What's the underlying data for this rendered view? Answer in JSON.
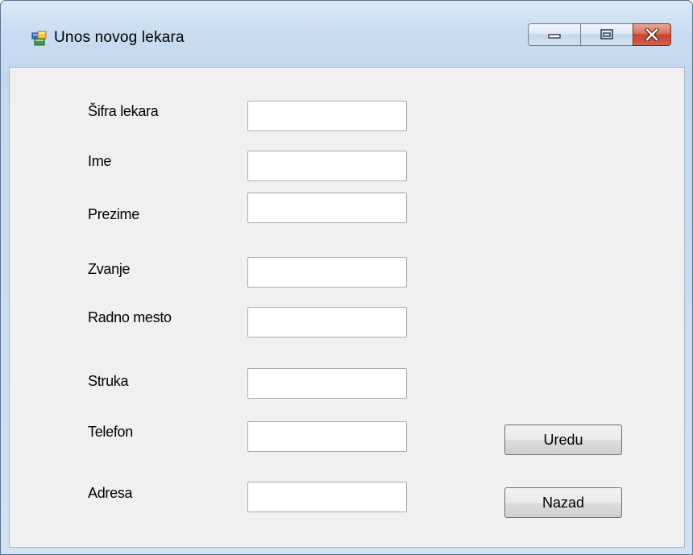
{
  "window": {
    "title": "Unos novog lekara",
    "icons": {
      "app": "app-window-icon",
      "minimize": "minimize-icon",
      "maximize": "maximize-icon",
      "close": "close-icon"
    },
    "colors": {
      "frame": "#c9dcf1",
      "client": "#f0f0f0",
      "close_button": "#c4442f"
    }
  },
  "form": {
    "fields": [
      {
        "label": "Šifra lekara",
        "value": ""
      },
      {
        "label": "Ime",
        "value": ""
      },
      {
        "label": "Prezime",
        "value": ""
      },
      {
        "label": "Zvanje",
        "value": ""
      },
      {
        "label": "Radno mesto",
        "value": ""
      },
      {
        "label": "Struka",
        "value": ""
      },
      {
        "label": "Telefon",
        "value": ""
      },
      {
        "label": "Adresa",
        "value": ""
      }
    ],
    "buttons": {
      "ok_label": "Uredu",
      "back_label": "Nazad"
    }
  }
}
